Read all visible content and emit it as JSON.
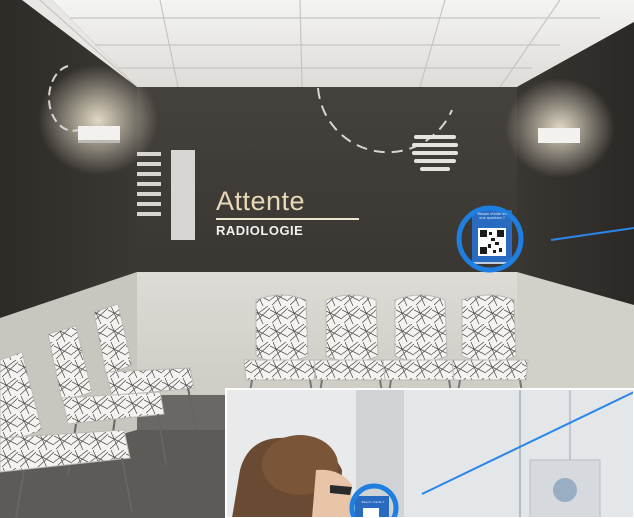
{
  "wall_sign": {
    "title": "Attente",
    "subtitle": "RADIOLOGIE"
  },
  "qr_sign": {
    "caption": "Besoin d'aide ou une question ?",
    "caption_small": "Besoin d'aide ?"
  },
  "colors": {
    "wall_dark": "#3d3935",
    "wall_lower": "#d9d6d1",
    "ceiling": "#eeeeec",
    "accent_text": "#e8d9b6",
    "highlight_circle": "#1e7fe0",
    "pointer_line": "#2a86e8"
  },
  "icons": [
    "qr-code-icon",
    "wall-lamp-icon"
  ]
}
